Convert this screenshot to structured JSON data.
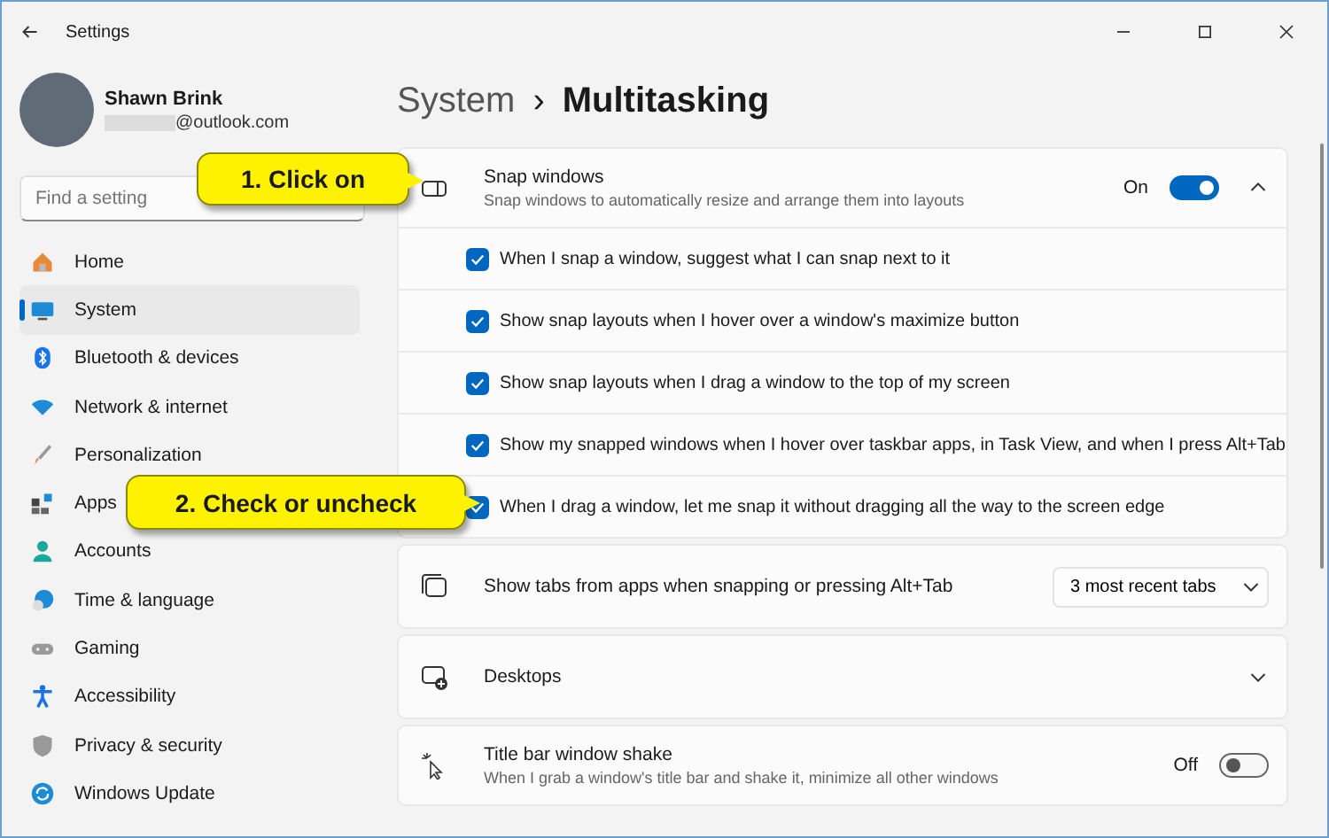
{
  "window": {
    "title": "Settings"
  },
  "account": {
    "name": "Shawn Brink",
    "email": "@outlook.com"
  },
  "search": {
    "placeholder": "Find a setting"
  },
  "nav": [
    {
      "label": "Home",
      "selected": false
    },
    {
      "label": "System",
      "selected": true
    },
    {
      "label": "Bluetooth & devices",
      "selected": false
    },
    {
      "label": "Network & internet",
      "selected": false
    },
    {
      "label": "Personalization",
      "selected": false
    },
    {
      "label": "Apps",
      "selected": false
    },
    {
      "label": "Accounts",
      "selected": false
    },
    {
      "label": "Time & language",
      "selected": false
    },
    {
      "label": "Gaming",
      "selected": false
    },
    {
      "label": "Accessibility",
      "selected": false
    },
    {
      "label": "Privacy & security",
      "selected": false
    },
    {
      "label": "Windows Update",
      "selected": false
    }
  ],
  "breadcrumb": {
    "parent": "System",
    "separator": "›",
    "current": "Multitasking"
  },
  "settings": [
    {
      "kind": "toggle",
      "title": "Snap windows",
      "description": "Snap windows to automatically resize and arrange them into layouts",
      "state_label": "On",
      "on": true,
      "expanded": true,
      "options": [
        {
          "label": "When I snap a window, suggest what I can snap next to it",
          "checked": true
        },
        {
          "label": "Show snap layouts when I hover over a window's maximize button",
          "checked": true
        },
        {
          "label": "Show snap layouts when I drag a window to the top of my screen",
          "checked": true
        },
        {
          "label": "Show my snapped windows when I hover over taskbar apps, in Task View, and when I press Alt+Tab",
          "checked": true
        },
        {
          "label": "When I drag a window, let me snap it without dragging all the way to the screen edge",
          "checked": true
        }
      ]
    },
    {
      "kind": "dropdown",
      "title": "Show tabs from apps when snapping or pressing Alt+Tab",
      "value": "3 most recent tabs"
    },
    {
      "kind": "expander",
      "title": "Desktops",
      "expanded": false
    },
    {
      "kind": "toggle",
      "title": "Title bar window shake",
      "description": "When I grab a window's title bar and shake it, minimize all other windows",
      "state_label": "Off",
      "on": false
    }
  ],
  "callouts": [
    {
      "text": "1. Click on"
    },
    {
      "text": "2. Check or uncheck"
    }
  ]
}
